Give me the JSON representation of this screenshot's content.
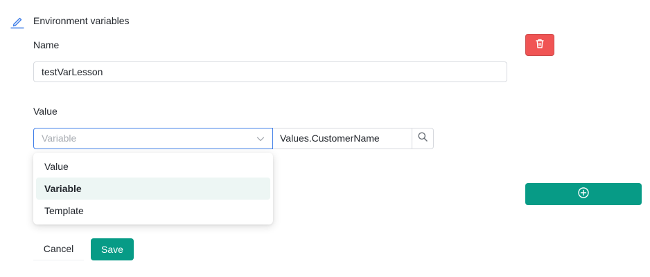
{
  "header": {
    "icon": "edit-pencil-icon",
    "title": "Environment variables"
  },
  "form": {
    "name_label": "Name",
    "name_value": "testVarLesson",
    "value_label": "Value",
    "value_type_select": {
      "placeholder": "Variable",
      "options": [
        "Value",
        "Variable",
        "Template"
      ],
      "highlighted_option": "Variable"
    },
    "value_input": "Values.CustomerName",
    "search_icon": "search-icon"
  },
  "actions": {
    "delete_icon": "trash-icon",
    "add_icon": "plus-circle-icon",
    "cancel_label": "Cancel",
    "save_label": "Save"
  },
  "colors": {
    "accent": "#079b86",
    "danger": "#f05454",
    "focus": "#3f7ee8",
    "selected_option_bg": "#edf6f4"
  }
}
